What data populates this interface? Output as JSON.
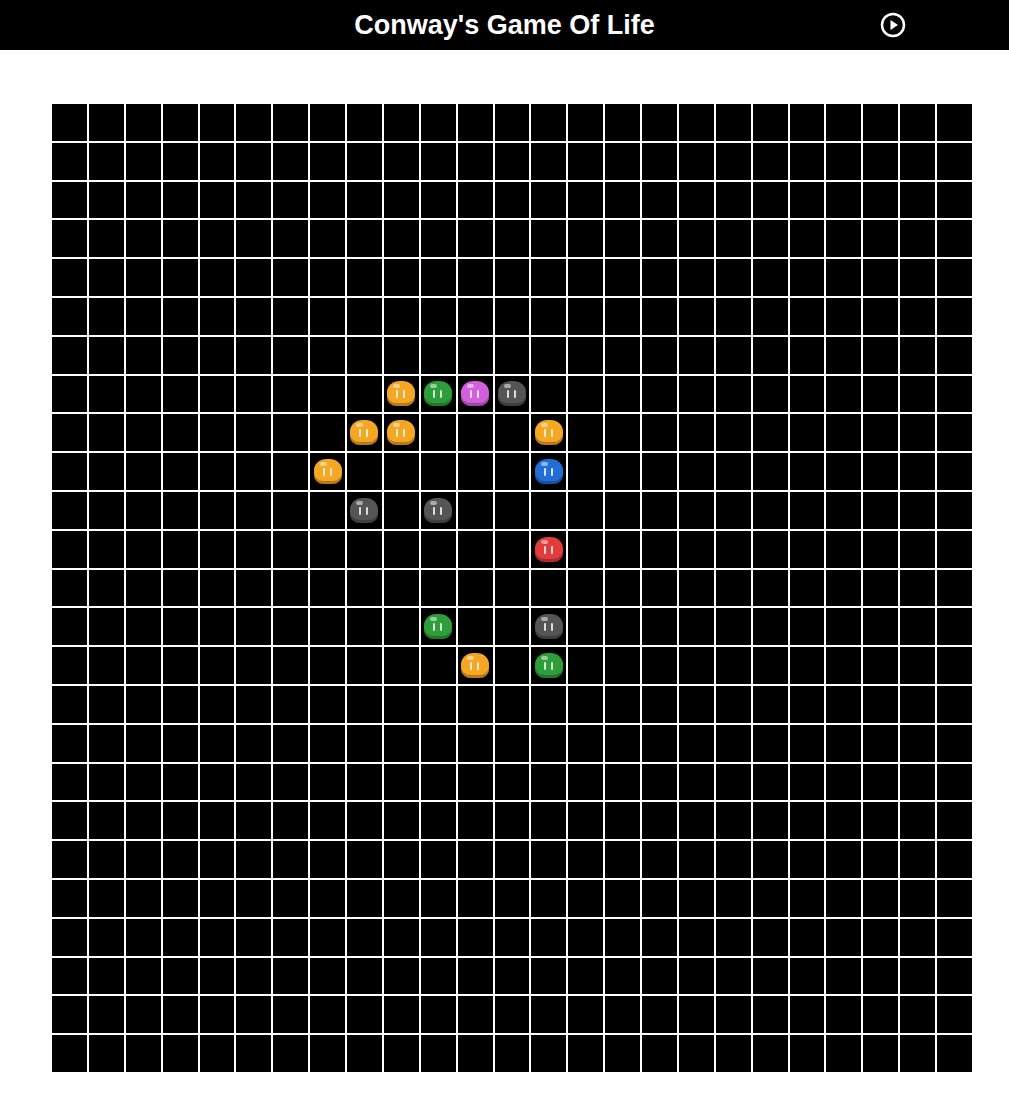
{
  "header": {
    "title": "Conway's Game Of Life",
    "running": false
  },
  "grid": {
    "rows": 25,
    "cols": 25,
    "alive": [
      {
        "row": 7,
        "col": 9,
        "color": "#f5a623"
      },
      {
        "row": 7,
        "col": 10,
        "color": "#2e9e3a"
      },
      {
        "row": 7,
        "col": 11,
        "color": "#d25fdc"
      },
      {
        "row": 7,
        "col": 12,
        "color": "#555555"
      },
      {
        "row": 8,
        "col": 8,
        "color": "#f5a623"
      },
      {
        "row": 8,
        "col": 9,
        "color": "#f5a623"
      },
      {
        "row": 8,
        "col": 13,
        "color": "#f5a623"
      },
      {
        "row": 9,
        "col": 7,
        "color": "#f5a623"
      },
      {
        "row": 9,
        "col": 13,
        "color": "#1f6fd6"
      },
      {
        "row": 10,
        "col": 8,
        "color": "#555555"
      },
      {
        "row": 10,
        "col": 10,
        "color": "#555555"
      },
      {
        "row": 11,
        "col": 13,
        "color": "#e23b3b"
      },
      {
        "row": 13,
        "col": 10,
        "color": "#2e9e3a"
      },
      {
        "row": 13,
        "col": 13,
        "color": "#555555"
      },
      {
        "row": 14,
        "col": 11,
        "color": "#f5a623"
      },
      {
        "row": 14,
        "col": 13,
        "color": "#2e9e3a"
      }
    ]
  }
}
